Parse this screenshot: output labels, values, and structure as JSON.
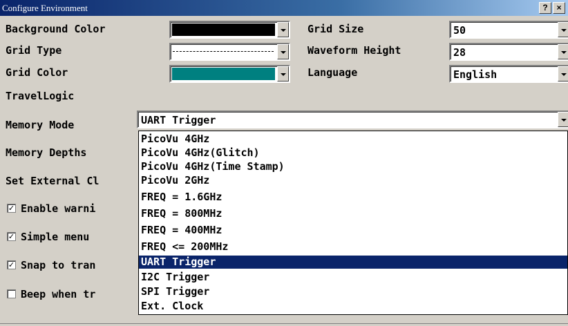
{
  "window": {
    "title": "Configure Environment",
    "help_btn": "?",
    "close_btn": "×"
  },
  "fields": {
    "background_color": {
      "label": "Background Color",
      "color": "#000000"
    },
    "grid_type": {
      "label": "Grid Type"
    },
    "grid_color": {
      "label": "Grid Color",
      "color": "#008080"
    },
    "grid_size": {
      "label": "Grid Size",
      "value": "50"
    },
    "waveform_height": {
      "label": "Waveform Height",
      "value": "28"
    },
    "language": {
      "label": "Language",
      "value": "English"
    },
    "travellogic": {
      "label": "TravelLogic",
      "value": "UART Trigger"
    },
    "memory_mode": {
      "label": "Memory Mode"
    },
    "memory_depths": {
      "label": "Memory Depths"
    },
    "set_external": {
      "label": "Set External Cl"
    }
  },
  "checkboxes": [
    {
      "label": "Enable warni",
      "checked": true,
      "mark": "✓"
    },
    {
      "label": "Simple menu",
      "checked": true,
      "mark": "✓"
    },
    {
      "label": "Snap to tran",
      "checked": true,
      "mark": "✓"
    },
    {
      "label": "Beep when tr",
      "checked": false,
      "mark": ""
    }
  ],
  "dropdown": {
    "selected": "UART Trigger",
    "options": [
      "PicoVu 4GHz",
      "PicoVu 4GHz(Glitch)",
      "PicoVu 4GHz(Time Stamp)",
      "PicoVu 2GHz",
      "FREQ = 1.6GHz",
      "FREQ = 800MHz",
      "FREQ = 400MHz",
      "FREQ <= 200MHz",
      "UART Trigger",
      "I2C Trigger",
      "SPI Trigger",
      "Ext. Clock"
    ]
  }
}
